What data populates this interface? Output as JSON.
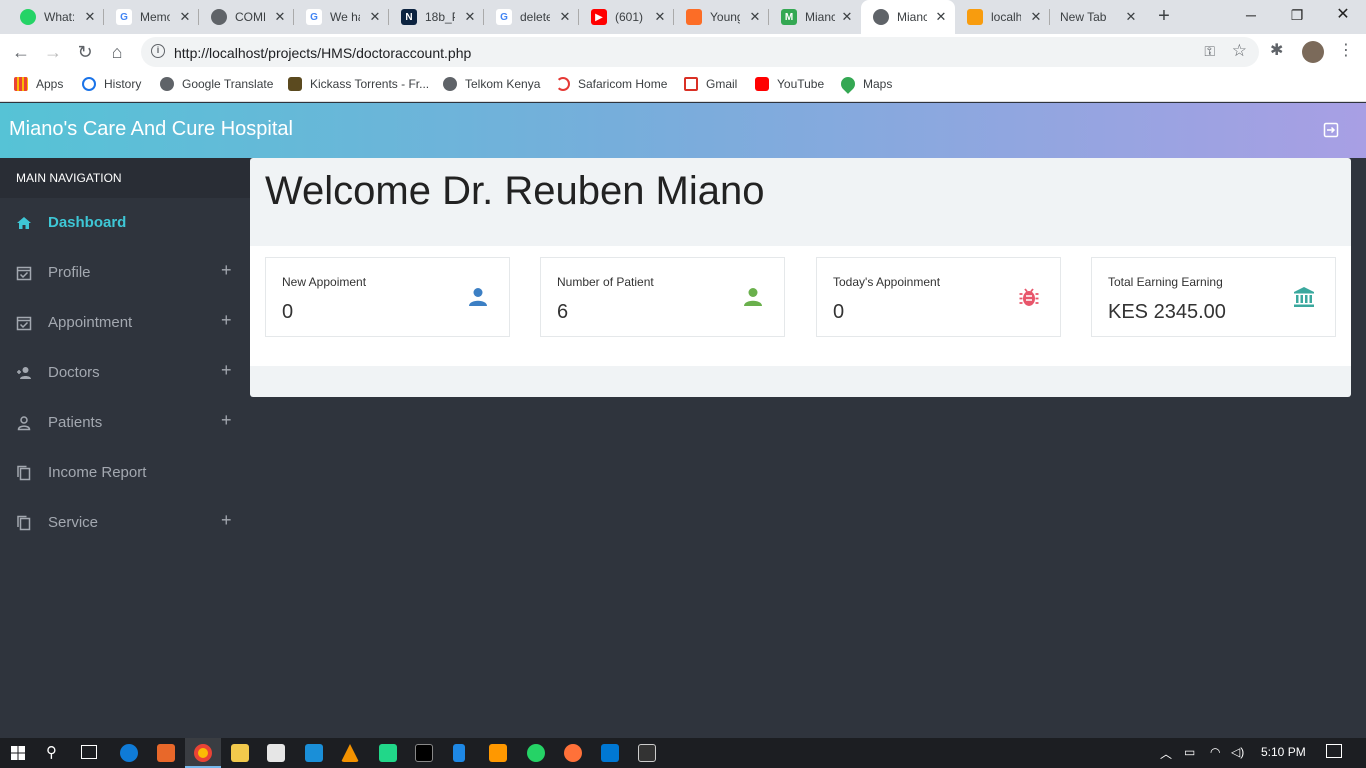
{
  "browser": {
    "tabs": [
      {
        "label": "What:",
        "favicon": "whatsapp-icon",
        "color": "#25d366"
      },
      {
        "label": "Memo",
        "favicon": "google-icon",
        "color": "#4285f4"
      },
      {
        "label": "COMF",
        "favicon": "globe-icon",
        "color": "#5f6368"
      },
      {
        "label": "We ha",
        "favicon": "google-icon",
        "color": "#4285f4"
      },
      {
        "label": "18b_P",
        "favicon": "nd-icon",
        "color": "#0c2340"
      },
      {
        "label": "delete",
        "favicon": "google-icon",
        "color": "#4285f4"
      },
      {
        "label": "(601)",
        "favicon": "youtube-icon",
        "color": "#ff0000"
      },
      {
        "label": "Young",
        "favicon": "gitlab-icon",
        "color": "#fc6d26"
      },
      {
        "label": "Mianc",
        "favicon": "sheet-icon",
        "color": "#34a853"
      },
      {
        "label": "Mianc",
        "favicon": "globe-icon",
        "color": "#5f6368",
        "active": true
      },
      {
        "label": "localh",
        "favicon": "phpmyadmin-icon",
        "color": "#f89c0e"
      },
      {
        "label": "New Tab",
        "favicon": "",
        "color": ""
      }
    ],
    "url": "http://localhost/projects/HMS/doctoraccount.php",
    "bookmarks": [
      {
        "label": "Apps",
        "icon": "apps-grid-icon",
        "color": "#4285f4"
      },
      {
        "label": "History",
        "icon": "history-icon",
        "color": "#1a73e8"
      },
      {
        "label": "Google Translate",
        "icon": "globe-icon",
        "color": "#5f6368"
      },
      {
        "label": "Kickass Torrents - Fr...",
        "icon": "kickass-icon",
        "color": "#5b4a1f"
      },
      {
        "label": "Telkom Kenya",
        "icon": "globe-icon",
        "color": "#5f6368"
      },
      {
        "label": "Safaricom Home",
        "icon": "safaricom-icon",
        "color": "#e53935"
      },
      {
        "label": "Gmail",
        "icon": "gmail-icon",
        "color": "#d93025"
      },
      {
        "label": "YouTube",
        "icon": "youtube-icon",
        "color": "#ff0000"
      },
      {
        "label": "Maps",
        "icon": "maps-icon",
        "color": "#34a853"
      }
    ]
  },
  "app": {
    "title": "Miano's Care And Cure Hospital"
  },
  "sidebar": {
    "header": "MAIN NAVIGATION",
    "items": [
      {
        "label": "Dashboard",
        "icon": "home-icon",
        "expandable": false,
        "active": true
      },
      {
        "label": "Profile",
        "icon": "calendar-check-icon",
        "expandable": true
      },
      {
        "label": "Appointment",
        "icon": "calendar-check-icon",
        "expandable": true
      },
      {
        "label": "Doctors",
        "icon": "user-add-icon",
        "expandable": true
      },
      {
        "label": "Patients",
        "icon": "user-icon",
        "expandable": true
      },
      {
        "label": "Income Report",
        "icon": "copy-icon",
        "expandable": false
      },
      {
        "label": "Service",
        "icon": "copy-icon",
        "expandable": true
      }
    ],
    "plus_symbol": "+"
  },
  "main": {
    "welcome": "Welcome Dr. Reuben Miano",
    "cards": [
      {
        "label": "New Appoiment",
        "value": "0",
        "icon": "user-icon",
        "color": "#3c7fc4"
      },
      {
        "label": "Number of Patient",
        "value": "6",
        "icon": "user-icon",
        "color": "#6ab04c"
      },
      {
        "label": "Today's Appoinment",
        "value": "0",
        "icon": "bug-icon",
        "color": "#e8566b"
      },
      {
        "label": "Total Earning Earning",
        "value": "KES 2345.00",
        "icon": "bank-icon",
        "color": "#3aa89e"
      }
    ]
  },
  "taskbar": {
    "time": "5:10 PM"
  },
  "colors": {
    "accent": "#3ec7d6",
    "sidebar_bg": "#2f343d",
    "header_gradient_start": "#56c3d6",
    "header_gradient_end": "#a89fe4"
  }
}
